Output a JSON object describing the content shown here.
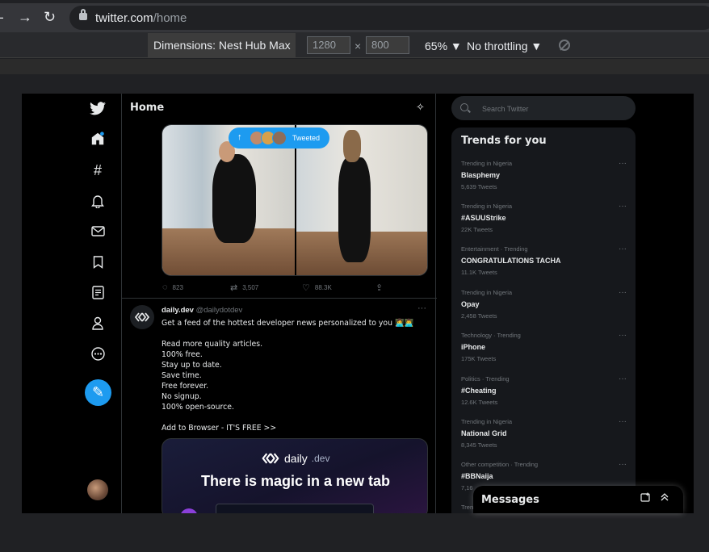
{
  "browser": {
    "url_domain": "twitter.com",
    "url_path": "/home",
    "devtools": {
      "dimensions_label": "Dimensions: Nest Hub Max",
      "width": "1280",
      "times": "×",
      "height": "800",
      "zoom": "65%",
      "throttling": "No throttling"
    }
  },
  "twitter": {
    "home_title": "Home",
    "tweeted_label": "Tweeted",
    "tweet1_actions": {
      "replies": "823",
      "retweets": "3,507",
      "likes": "88.3K"
    },
    "tweet2": {
      "author": "daily.dev",
      "handle": "@dailydotdev",
      "lines": [
        "Get a feed of the hottest developer news personalized to you 👩‍💻👨‍💻",
        "",
        "Read more quality articles.",
        "100% free.",
        "Stay up to date.",
        "Save time.",
        "Free forever.",
        "No signup.",
        "100% open-source.",
        "",
        "Add to Browser - IT'S FREE >>"
      ],
      "card_brand": "daily",
      "card_brand_suffix": ".dev",
      "card_headline": "There is magic in a new tab"
    },
    "search_placeholder": "Search Twitter",
    "trends_title": "Trends for you",
    "trends": [
      {
        "meta": "Trending in Nigeria",
        "name": "Blasphemy",
        "count": "5,639 Tweets"
      },
      {
        "meta": "Trending in Nigeria",
        "name": "#ASUUStrike",
        "count": "22K Tweets"
      },
      {
        "meta": "Entertainment · Trending",
        "name": "CONGRATULATIONS TACHA",
        "count": "11.1K Tweets"
      },
      {
        "meta": "Trending in Nigeria",
        "name": "Opay",
        "count": "2,458 Tweets"
      },
      {
        "meta": "Technology · Trending",
        "name": "iPhone",
        "count": "175K Tweets"
      },
      {
        "meta": "Politics · Trending",
        "name": "#Cheating",
        "count": "12.6K Tweets"
      },
      {
        "meta": "Trending in Nigeria",
        "name": "National Grid",
        "count": "8,345 Tweets"
      },
      {
        "meta": "Other competition · Trending",
        "name": "#BBNaija",
        "count": "7,16"
      },
      {
        "meta": "Tren",
        "name": "",
        "count": ""
      }
    ],
    "messages_title": "Messages",
    "colors": {
      "accent": "#1d9bf0",
      "background": "#000000",
      "panel": "#16181c"
    }
  }
}
